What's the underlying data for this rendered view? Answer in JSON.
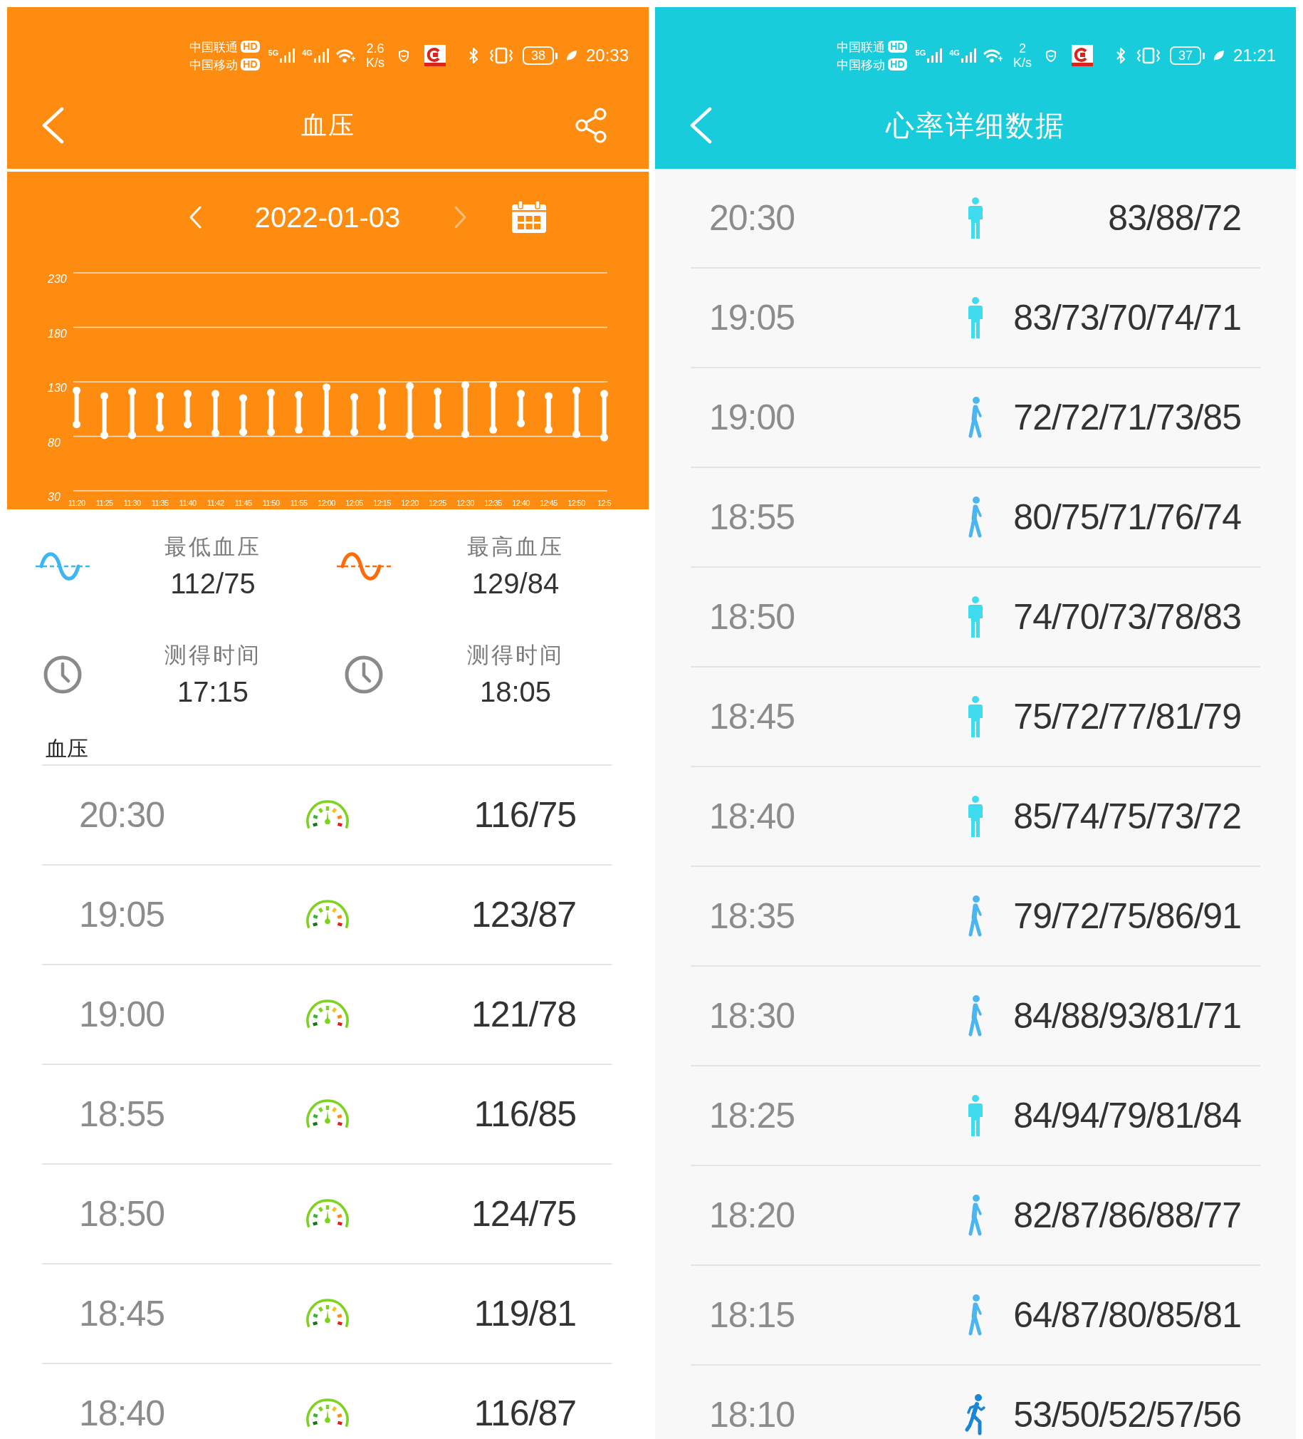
{
  "blood_pressure": {
    "status_bar": {
      "carriers": [
        {
          "name": "中国联通",
          "badge": "HD"
        },
        {
          "name": "中国移动",
          "badge": "HD"
        }
      ],
      "networks": [
        "5G",
        "4G"
      ],
      "speed": "2.6",
      "speed_unit": "K/s",
      "battery": "38",
      "time": "20:33"
    },
    "title": "血压",
    "share_button": true,
    "date_nav": {
      "prev": {
        "disabled": false
      },
      "date": "2022-01-03",
      "next": {
        "disabled": true
      }
    },
    "chart_data": {
      "type": "scatter",
      "categories": [
        "11:20",
        "11:25",
        "11:30",
        "11:35",
        "11:40",
        "11:42",
        "11:45",
        "11:50",
        "11:55",
        "12:00",
        "12:05",
        "12:15",
        "12:20",
        "12:25",
        "12:30",
        "12:35",
        "12:40",
        "12:45",
        "12:50",
        "12:5"
      ],
      "series": [
        {
          "values": [
            122,
            117,
            121,
            117,
            119,
            119,
            115,
            120,
            118,
            125,
            116,
            121,
            126,
            121,
            127,
            127,
            119,
            117,
            122,
            119
          ]
        },
        {
          "values": [
            91,
            81,
            81,
            88,
            91,
            83,
            84,
            84,
            86,
            83,
            84,
            89,
            81,
            90,
            82,
            86,
            92,
            86,
            82,
            79
          ]
        }
      ],
      "ylim": [
        30,
        230
      ],
      "yticks": [
        30,
        80,
        130,
        180,
        230
      ],
      "grid": true
    },
    "summary": [
      {
        "kind": "min",
        "label": "最低血压",
        "value": "112/75"
      },
      {
        "kind": "max",
        "label": "最高血压",
        "value": "129/84"
      },
      {
        "kind": "time",
        "label": "测得时间",
        "value": "17:15"
      },
      {
        "kind": "time",
        "label": "测得时间",
        "value": "18:05"
      }
    ],
    "section_title": "血压",
    "readings": [
      {
        "time": "20:30",
        "value": "116/75"
      },
      {
        "time": "19:05",
        "value": "123/87"
      },
      {
        "time": "19:00",
        "value": "121/78"
      },
      {
        "time": "18:55",
        "value": "116/85"
      },
      {
        "time": "18:50",
        "value": "124/75"
      },
      {
        "time": "18:45",
        "value": "119/81"
      },
      {
        "time": "18:40",
        "value": "116/87"
      }
    ]
  },
  "heart_rate": {
    "status_bar": {
      "carriers": [
        {
          "name": "中国联通",
          "badge": "HD"
        },
        {
          "name": "中国移动",
          "badge": "HD"
        }
      ],
      "networks": [
        "5G",
        "4G"
      ],
      "speed": "2",
      "speed_unit": "K/s",
      "battery": "37",
      "time": "21:21"
    },
    "title": "心率详细数据",
    "readings": [
      {
        "time": "20:30",
        "kind": "standing",
        "value": "83/88/72"
      },
      {
        "time": "19:05",
        "kind": "standing",
        "value": "83/73/70/74/71"
      },
      {
        "time": "19:00",
        "kind": "walking",
        "value": "72/72/71/73/85"
      },
      {
        "time": "18:55",
        "kind": "walking",
        "value": "80/75/71/76/74"
      },
      {
        "time": "18:50",
        "kind": "standing",
        "value": "74/70/73/78/83"
      },
      {
        "time": "18:45",
        "kind": "standing",
        "value": "75/72/77/81/79"
      },
      {
        "time": "18:40",
        "kind": "standing",
        "value": "85/74/75/73/72"
      },
      {
        "time": "18:35",
        "kind": "walking",
        "value": "79/72/75/86/91"
      },
      {
        "time": "18:30",
        "kind": "walking",
        "value": "84/88/93/81/71"
      },
      {
        "time": "18:25",
        "kind": "standing",
        "value": "84/94/79/81/84"
      },
      {
        "time": "18:20",
        "kind": "walking",
        "value": "82/87/86/88/77"
      },
      {
        "time": "18:15",
        "kind": "walking",
        "value": "64/87/80/85/81"
      },
      {
        "time": "18:10",
        "kind": "running",
        "value": "53/50/52/57/56"
      }
    ]
  }
}
